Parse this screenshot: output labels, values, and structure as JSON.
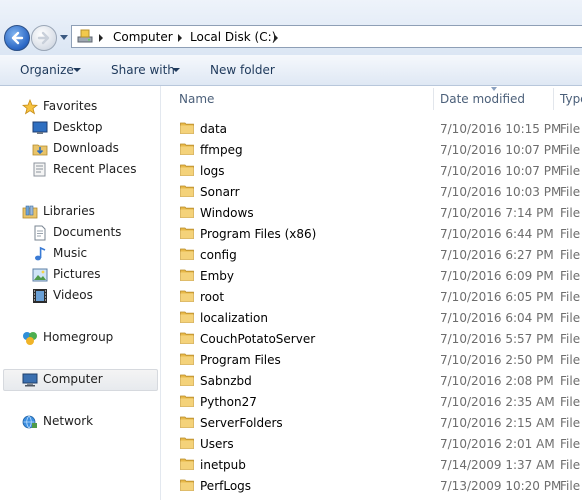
{
  "breadcrumb": [
    "Computer",
    "Local Disk (C:)"
  ],
  "toolbar": {
    "organize": "Organize",
    "share_with": "Share with",
    "new_folder": "New folder"
  },
  "nav": {
    "favorites": "Favorites",
    "desktop": "Desktop",
    "downloads": "Downloads",
    "recent_places": "Recent Places",
    "libraries": "Libraries",
    "documents": "Documents",
    "music": "Music",
    "pictures": "Pictures",
    "videos": "Videos",
    "homegroup": "Homegroup",
    "computer": "Computer",
    "network": "Network"
  },
  "columns": {
    "name": "Name",
    "date_modified": "Date modified",
    "type": "Type"
  },
  "files": [
    {
      "name": "data",
      "date": "7/10/2016 10:15 PM",
      "type": "File folder"
    },
    {
      "name": "ffmpeg",
      "date": "7/10/2016 10:07 PM",
      "type": "File folder"
    },
    {
      "name": "logs",
      "date": "7/10/2016 10:07 PM",
      "type": "File folder"
    },
    {
      "name": "Sonarr",
      "date": "7/10/2016 10:03 PM",
      "type": "File folder"
    },
    {
      "name": "Windows",
      "date": "7/10/2016 7:14 PM",
      "type": "File folder"
    },
    {
      "name": "Program Files (x86)",
      "date": "7/10/2016 6:44 PM",
      "type": "File folder"
    },
    {
      "name": "config",
      "date": "7/10/2016 6:27 PM",
      "type": "File folder"
    },
    {
      "name": "Emby",
      "date": "7/10/2016 6:09 PM",
      "type": "File folder"
    },
    {
      "name": "root",
      "date": "7/10/2016 6:05 PM",
      "type": "File folder"
    },
    {
      "name": "localization",
      "date": "7/10/2016 6:04 PM",
      "type": "File folder"
    },
    {
      "name": "CouchPotatoServer",
      "date": "7/10/2016 5:57 PM",
      "type": "File folder"
    },
    {
      "name": "Program Files",
      "date": "7/10/2016 2:50 PM",
      "type": "File folder"
    },
    {
      "name": "Sabnzbd",
      "date": "7/10/2016 2:08 PM",
      "type": "File folder"
    },
    {
      "name": "Python27",
      "date": "7/10/2016 2:35 AM",
      "type": "File folder"
    },
    {
      "name": "ServerFolders",
      "date": "7/10/2016 2:15 AM",
      "type": "File folder"
    },
    {
      "name": "Users",
      "date": "7/10/2016 2:01 AM",
      "type": "File folder"
    },
    {
      "name": "inetpub",
      "date": "7/14/2009 1:37 AM",
      "type": "File folder"
    },
    {
      "name": "PerfLogs",
      "date": "7/13/2009 10:20 PM",
      "type": "File folder"
    }
  ],
  "icons": {
    "back": "back-arrow-icon",
    "forward": "forward-arrow-icon",
    "folder": "folder-icon",
    "favorites": "star-icon",
    "libraries": "libraries-icon",
    "homegroup": "homegroup-icon",
    "computer": "computer-icon",
    "network": "network-icon"
  }
}
